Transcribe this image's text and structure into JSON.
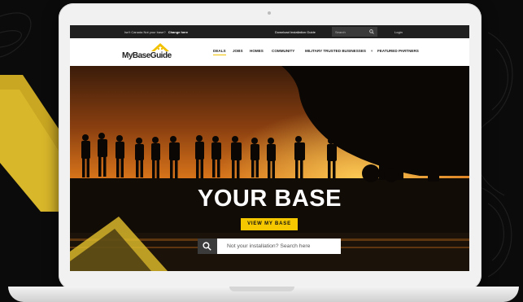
{
  "topbar": {
    "notice": "Isn't Canada Not your base?",
    "change_link": "Change here",
    "download": "Download Installation Guide",
    "search_placeholder": "Search",
    "login": "Login"
  },
  "logo": {
    "text": "MyBaseGuide"
  },
  "nav": {
    "items": [
      {
        "label": "DEALS"
      },
      {
        "label": "JOBS"
      },
      {
        "label": "HOMES"
      },
      {
        "label": "COMMUNITY"
      },
      {
        "label": "MILITARY TRUSTED BUSINESSES"
      },
      {
        "label": "FEATURED PARTNERS"
      }
    ]
  },
  "hero": {
    "title": "YOUR BASE",
    "button": "VIEW MY BASE",
    "search_placeholder": "Not your installation? Search here"
  },
  "colors": {
    "accent": "#f6c800",
    "topbar": "#1f1f1f",
    "background": "#0b0b0b"
  }
}
